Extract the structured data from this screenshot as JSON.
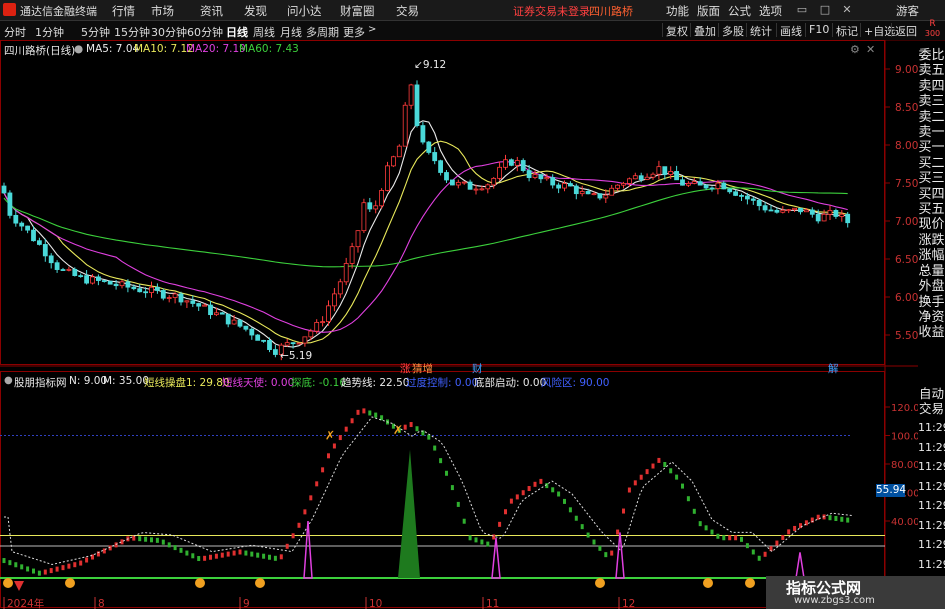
{
  "titlebar": {
    "app_name": "通达信金融终端",
    "menus": [
      "行情",
      "市场",
      "资讯",
      "发现",
      "问小达",
      "财富圈",
      "交易"
    ],
    "warning": "证券交易未登录",
    "stock_name": "四川路桥",
    "right_menus": [
      "功能",
      "版面",
      "公式",
      "选项"
    ],
    "user": "游客",
    "window_buttons": [
      "minimize-icon",
      "maximize-icon",
      "close-icon"
    ]
  },
  "toolbar": {
    "periods": [
      "分时",
      "1分钟",
      "5分钟",
      "15分钟",
      "30分钟",
      "60分钟",
      "日线",
      "周线",
      "月线",
      "多周期",
      "更多"
    ],
    "active_period": "日线",
    "buttons": [
      "复权",
      "叠加",
      "多股",
      "统计",
      "画线",
      "F10",
      "标记",
      "+自选",
      "返回"
    ],
    "corner_labels": [
      "R",
      "300"
    ]
  },
  "main_panel": {
    "title": "四川路桥(日线)",
    "ma_labels": [
      {
        "text": "MA5: 7.04",
        "color": "#eaeaea"
      },
      {
        "text": "MA10: 7.12",
        "color": "#e8e85a"
      },
      {
        "text": "MA20: 7.19",
        "color": "#e040e0"
      },
      {
        "text": "MA60: 7.43",
        "color": "#3cd03c"
      }
    ],
    "price_axis": [
      "9.00",
      "8.50",
      "8.00",
      "7.50",
      "7.00",
      "6.50",
      "6.00",
      "5.50"
    ],
    "high_marker": "9.12",
    "low_marker": "5.19",
    "event_tags": [
      "涨",
      "猜增",
      "财",
      "解"
    ]
  },
  "indicator_panel": {
    "name": "股朋指标网",
    "params": [
      {
        "text": "N: 9.00",
        "color": "#eaeaea"
      },
      {
        "text": "M: 35.00",
        "color": "#eaeaea"
      },
      {
        "text": "短线操盘1: 29.80",
        "color": "#e8e85a"
      },
      {
        "text": "短线天使: 0.00",
        "color": "#e040e0"
      },
      {
        "text": "探底: -0.16",
        "color": "#3cd03c"
      },
      {
        "text": "趋势线: 22.50",
        "color": "#eaeaea"
      },
      {
        "text": "过度控制: 0.00",
        "color": "#4060ff"
      },
      {
        "text": "底部启动: 0.00",
        "color": "#eaeaea"
      },
      {
        "text": "风险区: 90.00",
        "color": "#4060ff"
      }
    ],
    "axis": [
      "120.0",
      "100.0",
      "80.00",
      "60.00",
      "40.00"
    ],
    "current_value": "55.94"
  },
  "date_axis": [
    "2024年",
    "8",
    "9",
    "10",
    "11",
    "12"
  ],
  "right_sidebar": {
    "order_book": [
      "委比",
      "卖五",
      "卖四",
      "卖三",
      "卖二",
      "卖一",
      "买一",
      "买二",
      "买三",
      "买四",
      "买五",
      "现价",
      "涨跌",
      "涨幅",
      "总量",
      "外盘",
      "换手",
      "净资",
      "收益"
    ],
    "lower": [
      "自动",
      "交易"
    ],
    "times": [
      "11:29",
      "11:29",
      "11:29",
      "11:29",
      "11:29",
      "11:29",
      "11:29",
      "11:29",
      "11:29"
    ]
  },
  "watermark": {
    "title": "指标公式网",
    "url": "www.zbgs3.com"
  },
  "colors": {
    "up": "#ff3b3b",
    "down": "#4ad9d9",
    "ma5": "#eaeaea",
    "ma10": "#e8e85a",
    "ma20": "#e040e0",
    "ma60": "#3cd03c",
    "panel_border": "#8b0000"
  }
}
